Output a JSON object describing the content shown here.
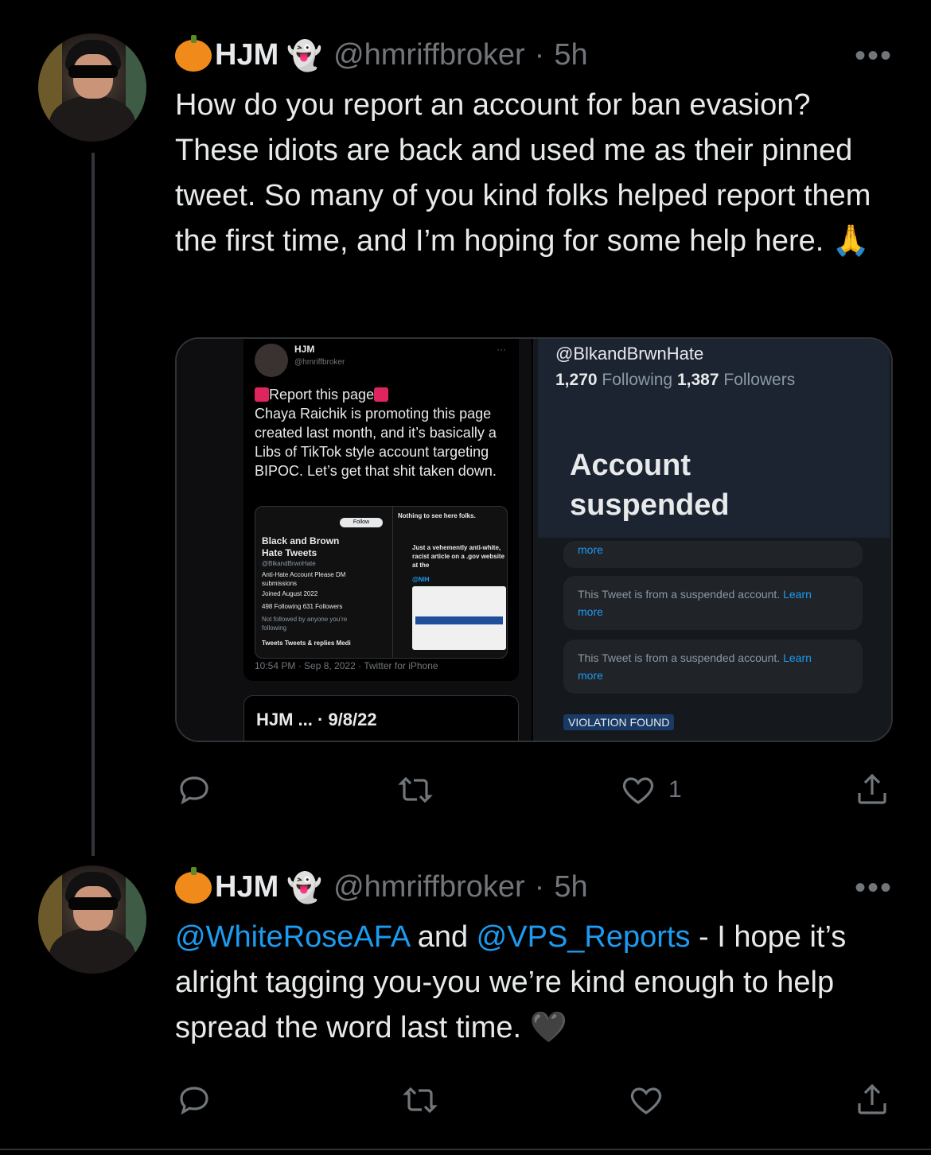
{
  "tweets": [
    {
      "display_name": "HJM",
      "handle": "@hmriffbroker",
      "time": "5h",
      "more_label": "•••",
      "text": "How do you report an account for ban evasion? These idiots are back and used me as their pinned tweet. So many of you kind folks helped report them the first time, and  I’m hoping for some help here. 🙏",
      "actions": {
        "reply_count": "",
        "retweet_count": "",
        "like_count": "1"
      },
      "media": {
        "left": {
          "name": "HJM",
          "handle": "@hmriffbroker",
          "more": "···",
          "report_title": "Report this page",
          "body": "Chaya Raichik is promoting this page created last month, and it’s basically a Libs of TikTok style account targeting BIPOC. Let’s get that shit taken down.",
          "embed": {
            "follow": "Follow",
            "profile_name": "Black and Brown Hate Tweets",
            "profile_handle": "@BlkandBrwnHate",
            "bio": "Anti-Hate Account Please DM submissions",
            "joined": "Joined August 2022",
            "following": "498 Following  631 Followers",
            "not_followed": "Not followed by anyone you’re following",
            "tabs": "Tweets   Tweets & replies   Medi",
            "nothing": "Nothing to see here folks.",
            "quote": "Just a vehemently anti-white, racist article on a .gov website at the",
            "nih": "@NIH"
          },
          "footer": "10:54 PM · Sep 8, 2022 · Twitter for iPhone",
          "next": "HJM ... · 9/8/22"
        },
        "right": {
          "handle": "@BlkandBrwnHate",
          "following_count": "1,270",
          "following_label": "Following",
          "followers_count": "1,387",
          "followers_label": "Followers",
          "suspended": "Account suspended",
          "bubble_more": "more",
          "bubble_text": "This Tweet is from a suspended account.",
          "bubble_learn": "Learn",
          "violation": "VIOLATION FOUND"
        }
      }
    },
    {
      "display_name": "HJM",
      "handle": "@hmriffbroker",
      "time": "5h",
      "more_label": "•••",
      "mention1": "@WhiteRoseAFA",
      "and": " and ",
      "mention2": "@VPS_Reports",
      "text": " - I hope it’s alright tagging you-you we’re kind enough to help spread the word last time. 🖤",
      "actions": {
        "reply_count": "",
        "retweet_count": "",
        "like_count": ""
      }
    }
  ],
  "colors": {
    "accent": "#1d9bf0",
    "muted": "#71767b",
    "background": "#000000"
  },
  "icons": [
    "pumpkin-icon",
    "ghost-icon",
    "more-icon",
    "reply-icon",
    "retweet-icon",
    "like-icon",
    "share-icon"
  ]
}
